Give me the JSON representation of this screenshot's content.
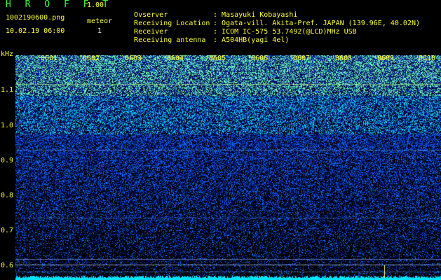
{
  "header": {
    "app_title": "H R O F F T",
    "app_version": "1.00",
    "file_name": "1002190600.png",
    "datetime": "10.02.19 06:00",
    "meteor_label": "meteor",
    "meteor_count": "1"
  },
  "info": [
    {
      "key": "Ovserver",
      "value": "Masayuki Kobayashi"
    },
    {
      "key": "Receiving Location",
      "value": "Ogata-vill. Akita-Pref. JAPAN (139.96E, 40.02N)"
    },
    {
      "key": "Receiver",
      "value": "ICOM IC-575 53.7492(@LCD)MHz USB"
    },
    {
      "key": "Receiving antenna",
      "value": "A504HB(yagi 4el)"
    }
  ],
  "axis": {
    "y_unit": "kHz",
    "y_ticks": [
      "1.1",
      "1.0",
      "0.9",
      "0.8",
      "0.7",
      "0.6"
    ],
    "x_ticks": [
      "0601",
      "0602",
      "0603",
      "0604",
      "0605",
      "0606",
      "0607",
      "0608",
      "0609",
      "0610"
    ]
  },
  "colors": {
    "background": "#000000",
    "label_yellow": "#ffff33",
    "title_green": "#33ff33",
    "signal_cyan": "#00e5ff",
    "noise_blue": "#1030ff"
  }
}
